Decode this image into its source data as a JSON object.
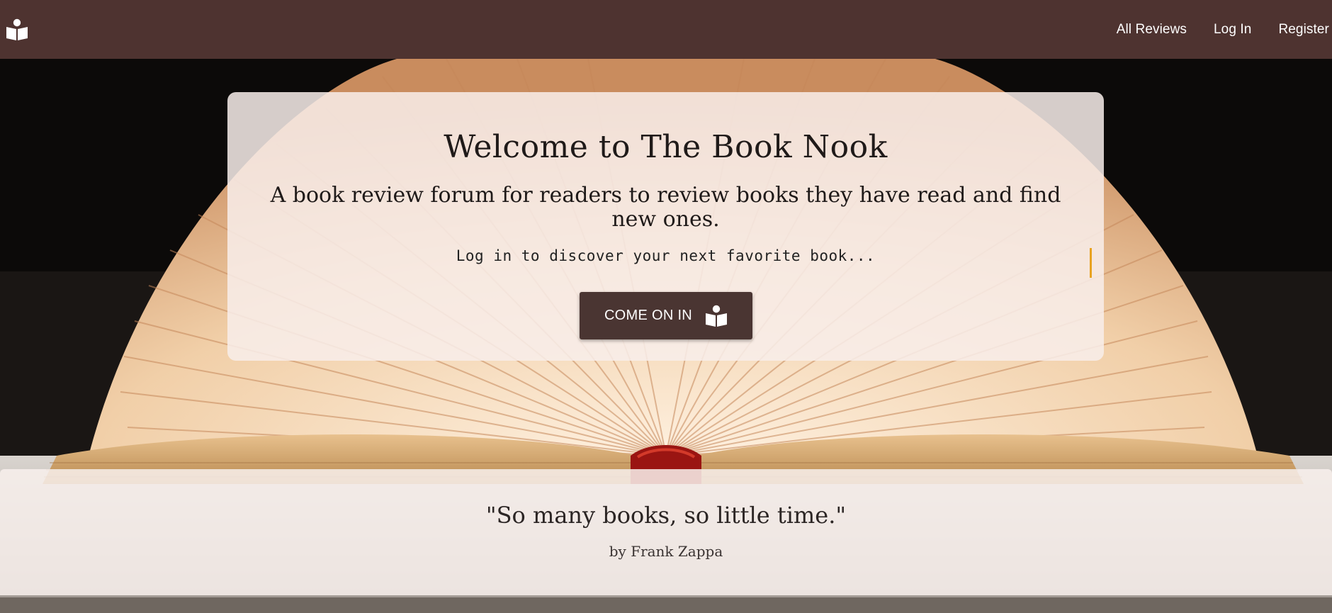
{
  "navbar": {
    "logo_icon": "book-reader-icon",
    "links": [
      "All Reviews",
      "Log In",
      "Register"
    ],
    "background": "#4e3330"
  },
  "welcome": {
    "title": "Welcome to The Book Nook",
    "subtitle": "A book review forum for readers to review books they have read and find new ones.",
    "typing_text": "Log in to discover your next favorite book...",
    "cta_label": "COME ON IN",
    "cta_icon": "book-reader-icon",
    "accent_color": "#e8a21f"
  },
  "quote": {
    "text": "\"So many books, so little time.\"",
    "author": "by Frank Zappa"
  }
}
